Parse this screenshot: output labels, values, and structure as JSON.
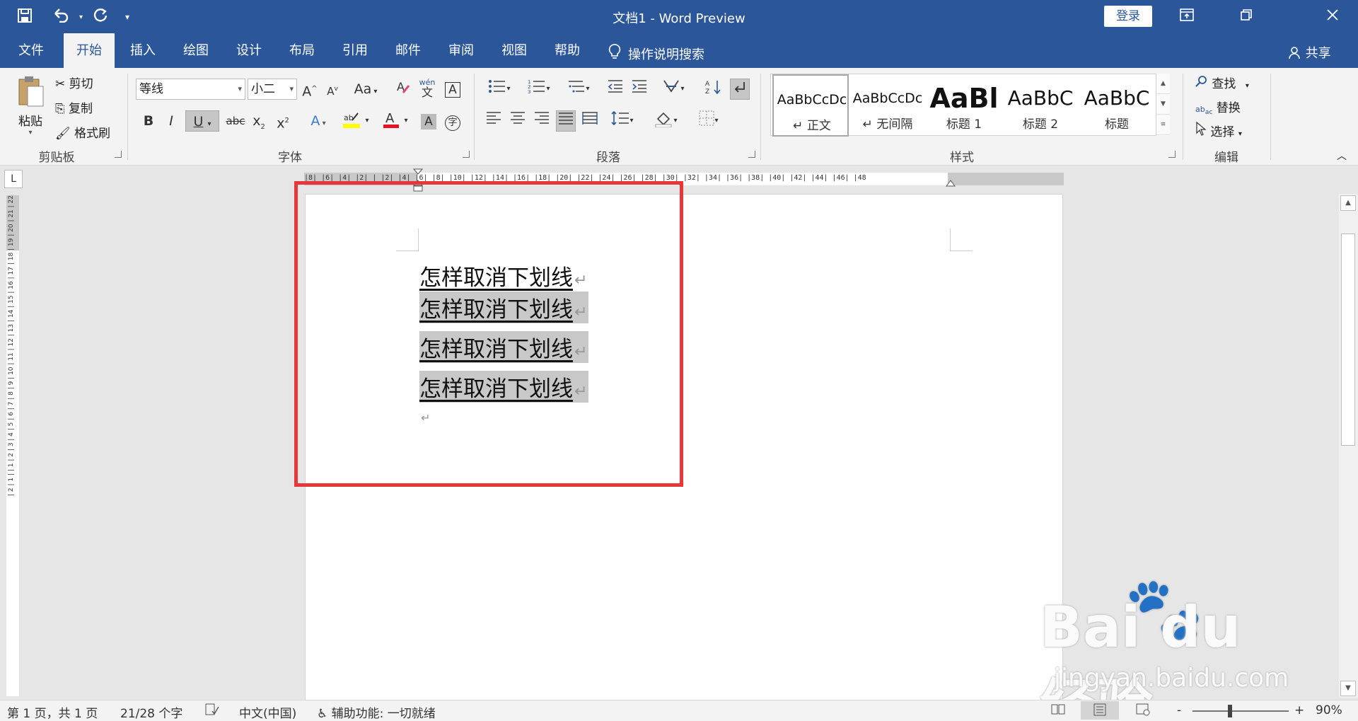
{
  "window": {
    "title": "文档1  -  Word Preview",
    "login_label": "登录",
    "ribbon_display_icon": "ribbon-display-icon",
    "restore_icon": "restore-icon",
    "close_icon": "close-icon"
  },
  "qat": {
    "save_icon": "save-icon",
    "undo_icon": "undo-icon",
    "redo_icon": "redo-icon",
    "customize_icon": "customize-icon"
  },
  "tabs": [
    {
      "label": "文件"
    },
    {
      "label": "开始"
    },
    {
      "label": "插入"
    },
    {
      "label": "绘图"
    },
    {
      "label": "设计"
    },
    {
      "label": "布局"
    },
    {
      "label": "引用"
    },
    {
      "label": "邮件"
    },
    {
      "label": "审阅"
    },
    {
      "label": "视图"
    },
    {
      "label": "帮助"
    }
  ],
  "tell_me": "操作说明搜索",
  "share": "共享",
  "ribbon": {
    "clipboard": {
      "paste": "粘贴",
      "cut": "剪切",
      "copy": "复制",
      "format_painter": "格式刷",
      "label": "剪贴板"
    },
    "font": {
      "font_name": "等线",
      "font_size": "小二",
      "bold": "B",
      "italic": "I",
      "underline": "U",
      "strikethrough": "abc",
      "subscript": "x",
      "subscript_mark": "2",
      "superscript": "x",
      "superscript_mark": "2",
      "label": "字体",
      "change_case": "Aa",
      "phonetic_top": "wén",
      "phonetic_bottom": "文"
    },
    "paragraph": {
      "label": "段落"
    },
    "styles": {
      "label": "样式",
      "items": [
        {
          "sample": "AaBbCcDc",
          "name": "↵ 正文"
        },
        {
          "sample": "AaBbCcDc",
          "name": "↵ 无间隔"
        },
        {
          "sample": "AaBl",
          "name": "标题 1"
        },
        {
          "sample": "AaBbC",
          "name": "标题 2"
        },
        {
          "sample": "AaBbC",
          "name": "标题"
        }
      ]
    },
    "editing": {
      "find": "查找",
      "replace": "替换",
      "select": "选择",
      "label": "编辑"
    }
  },
  "ruler": {
    "h_ticks": "|8| |6| |4| |2| | |2| |4| |6| |8| |10| |12| |14| |16| |18| |20| |22| |24| |26| |28| |30| |32| |34| |36| |38| |40| |42| |44| |46| |48",
    "v_ticks": "| 2 | 1 | | 1 | 2 | 3 | 4 | 5 | 6 | 7 | 8 | 9 | 10 | 11 | 12 | 13 | 14 | 15 | 16 | 17 | 18 | 19 | 20 | 21 | 22"
  },
  "document": {
    "lines": [
      {
        "text": "怎样取消下划线",
        "selected": false
      },
      {
        "text": "怎样取消下划线",
        "selected": true
      },
      {
        "text": "怎样取消下划线",
        "selected": true
      },
      {
        "text": "怎样取消下划线",
        "selected": true
      }
    ],
    "para_mark": "↵"
  },
  "status": {
    "page": "第 1 页，共 1 页",
    "words": "21/28 个字",
    "language": "中文(中国)",
    "accessibility": "辅助功能: 一切就绪",
    "zoom": "90%",
    "zoom_minus": "-",
    "zoom_plus": "+"
  },
  "watermark": {
    "logo": "Bai du 经验",
    "site": "jingyan.baidu.com"
  },
  "colors": {
    "brand": "#2b579a",
    "selection": "#c8c8c8",
    "annotation_box": "#e8373a",
    "highlight_yellow": "#ffff00",
    "font_color_red": "#e81123"
  }
}
